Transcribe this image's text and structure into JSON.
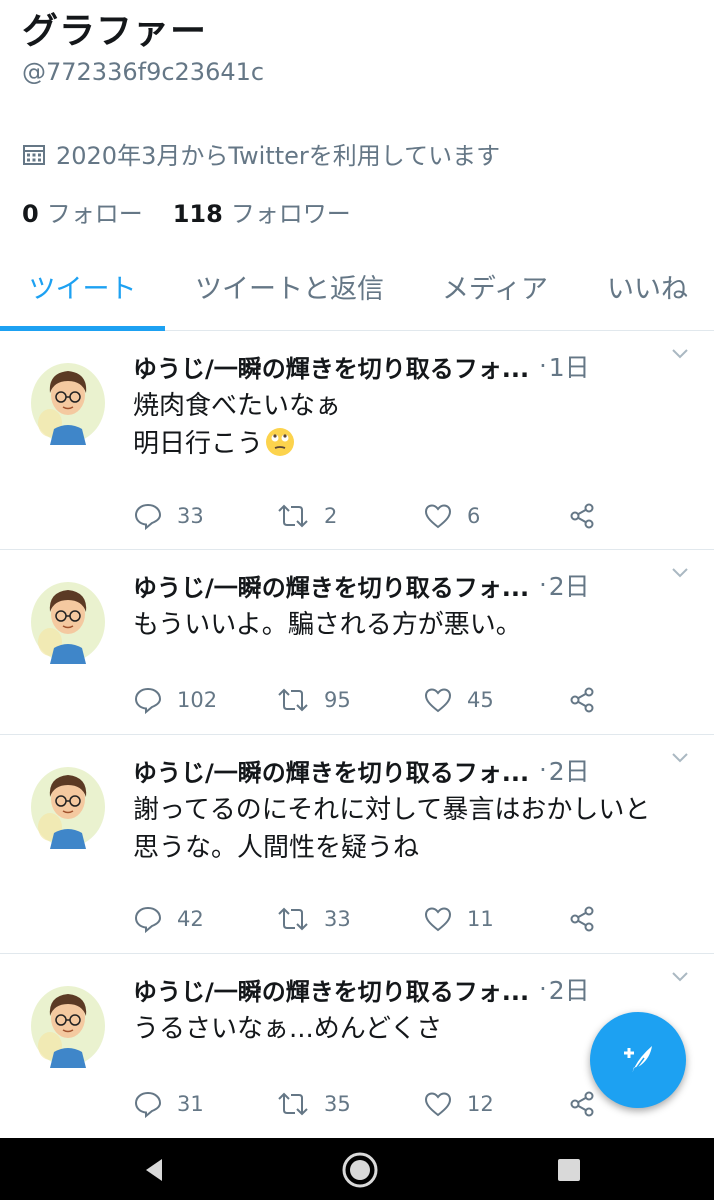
{
  "profile": {
    "name": "グラファー",
    "handle": "@772336f9c23641c",
    "joined": "2020年3月からTwitterを利用しています",
    "following_count": "0",
    "following_label": "フォロー",
    "followers_count": "118",
    "followers_label": "フォロワー"
  },
  "tabs": [
    {
      "label": "ツイート",
      "active": true
    },
    {
      "label": "ツイートと返信",
      "active": false
    },
    {
      "label": "メディア",
      "active": false
    },
    {
      "label": "いいね",
      "active": false
    }
  ],
  "tweets": [
    {
      "author": "ゆうじ/一瞬の輝きを切り取るフォ...",
      "separator": "·",
      "time": "1日",
      "text": "焼肉食べたいなぁ\n明日行こう",
      "emoji": "rolling-eyes-emoji",
      "replies": "33",
      "retweets": "2",
      "likes": "6"
    },
    {
      "author": "ゆうじ/一瞬の輝きを切り取るフォ...",
      "separator": "·",
      "time": "2日",
      "text": "もういいよ。騙される方が悪い。",
      "replies": "102",
      "retweets": "95",
      "likes": "45"
    },
    {
      "author": "ゆうじ/一瞬の輝きを切り取るフォ...",
      "separator": "·",
      "time": "2日",
      "text": "謝ってるのにそれに対して暴言はおかしいと\n思うな。人間性を疑うね",
      "replies": "42",
      "retweets": "33",
      "likes": "11"
    },
    {
      "author": "ゆうじ/一瞬の輝きを切り取るフォ...",
      "separator": "·",
      "time": "2日",
      "text": "うるさいなぁ...めんどくさ",
      "replies": "31",
      "retweets": "35",
      "likes": "12"
    }
  ],
  "colors": {
    "accent": "#1da1f2",
    "muted": "#657786",
    "text": "#14171a",
    "border": "#e1e8ed"
  },
  "icons": {
    "joined": "calendar-icon",
    "reply": "reply-icon",
    "retweet": "retweet-icon",
    "like": "heart-icon",
    "share": "share-icon",
    "more": "chevron-down-icon",
    "compose": "compose-tweet-icon",
    "nav": [
      "nav-back-icon",
      "nav-home-icon",
      "nav-recents-icon"
    ]
  }
}
